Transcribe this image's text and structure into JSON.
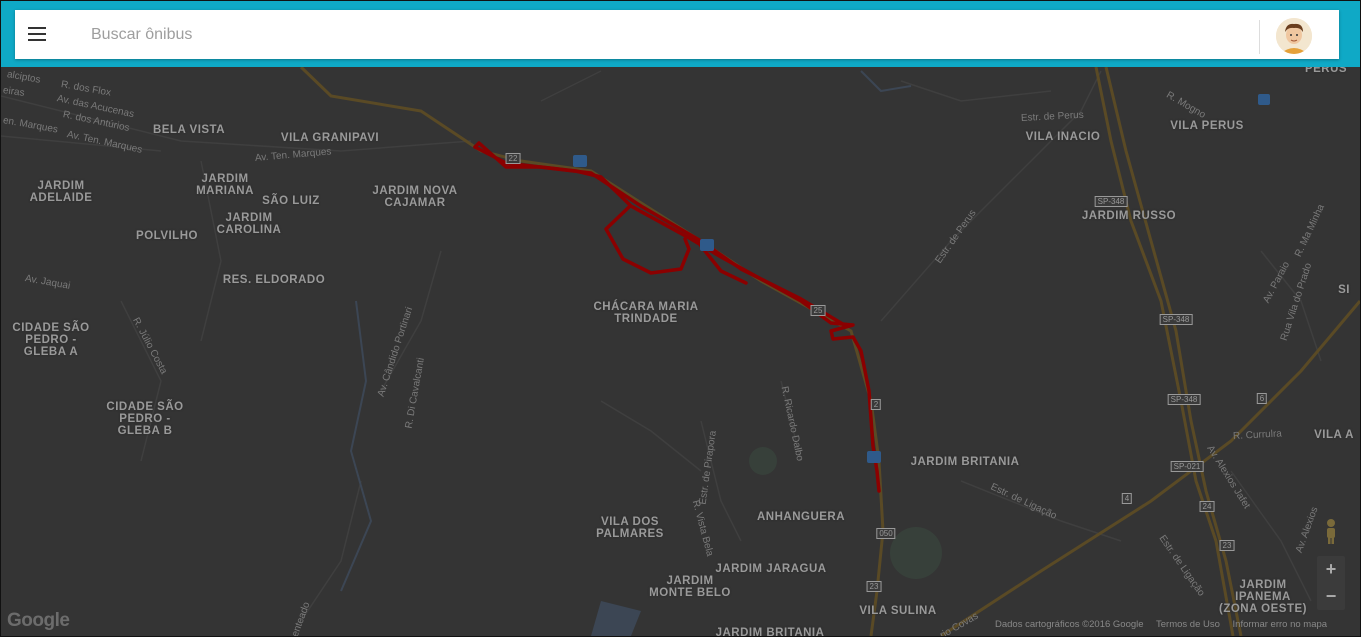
{
  "search": {
    "placeholder": "Buscar ônibus"
  },
  "icons": {
    "menu": "hamburger-menu-icon",
    "avatar": "user-avatar-icon",
    "bus_stop": "bus-stop-icon",
    "pegman": "street-view-pegman-icon"
  },
  "colors": {
    "topbar": "#0fa9c6",
    "route": "#8b0000",
    "map_overlay": "#333333"
  },
  "map": {
    "neighborhoods": [
      "BELA VISTA",
      "VILA GRANIPAVI",
      "JARDIM\nADELAIDE",
      "JARDIM\nMARIANA",
      "SÃO LUIZ",
      "JARDIM NOVA\nCAJAMAR",
      "JARDIM\nCAROLINA",
      "POLVILHO",
      "RES. ELDORADO",
      "CHÁCARA MARIA\nTRINDADE",
      "CIDADE SÃO\nPEDRO -\nGLEBA A",
      "CIDADE SÃO\nPEDRO -\nGLEBA B",
      "VILA INACIO",
      "VILA PERUS",
      "JARDIM RUSSO",
      "JARDIM BRITANIA",
      "ANHANGUERA",
      "VILA DOS\nPALMARES",
      "JARDIM JARAGUA",
      "JARDIM\nMONTE BELO",
      "VILA SULINA",
      "JARDIM\nIPANEMA\n(ZONA OESTE)",
      "VILA A",
      "JARDIM BRITANIA",
      "PERUS",
      "SI"
    ],
    "streets": [
      "R. dos Flox",
      "Av. das Acucenas",
      "R. dos Antúrios",
      "en. Marques",
      "Av. Ten. Marques",
      "Av. Ten. Marques",
      "alciptos",
      "eiras",
      "Av. Jaquai",
      "R. Júlio Costa",
      "Av. Cândido Portinari",
      "R. Di Cavalcanti",
      "Estr. de Perus",
      "Estr. de Perus",
      "R. Mogno",
      "Estr. de Pirapora",
      "R. Vista Bela",
      "R. Ricardo Dalbo",
      "Estr. de Ligação",
      "Estr. de Ligação",
      "Av. Paraio",
      "R. Ma Minha",
      "Rua Vila do Prado",
      "R. Currulra",
      "Av. Alexios Jafet",
      "Av. Alexios",
      "enteado",
      "rio Covas"
    ],
    "shields": [
      "SP-348",
      "SP-348",
      "SP-348",
      "SP-021",
      "050",
      "23",
      "25",
      "22",
      "24",
      "23",
      "6",
      "4",
      "2"
    ]
  },
  "attribution": {
    "data": "Dados cartográficos ©2016 Google",
    "terms": "Termos de Uso",
    "report": "Informar erro no mapa"
  },
  "logo": "Google",
  "zoom": {
    "in": "+",
    "out": "−"
  }
}
